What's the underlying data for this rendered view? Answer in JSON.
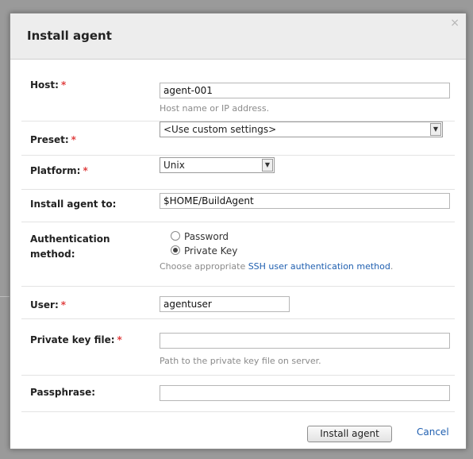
{
  "dialog": {
    "title": "Install agent",
    "close_glyph": "×"
  },
  "required_marker": "*",
  "fields": {
    "host": {
      "label": "Host:",
      "value": "agent-001",
      "hint": "Host name or IP address."
    },
    "preset": {
      "label": "Preset:",
      "value": "<Use custom settings>"
    },
    "platform": {
      "label": "Platform:",
      "value": "Unix"
    },
    "install_to": {
      "label": "Install agent to:",
      "value": "$HOME/BuildAgent"
    },
    "auth": {
      "label_line1": "Authentication",
      "label_line2": "method:",
      "options": [
        "Password",
        "Private Key"
      ],
      "selected": "Private Key",
      "hint_prefix": "Choose appropriate ",
      "hint_link": "SSH user authentication method",
      "hint_suffix": "."
    },
    "user": {
      "label": "User:",
      "value": "agentuser"
    },
    "key_file": {
      "label": "Private key file:",
      "value": "",
      "hint": "Path to the private key file on server."
    },
    "passphrase": {
      "label": "Passphrase:",
      "value": ""
    }
  },
  "footer": {
    "install_label": "Install agent",
    "cancel_label": "Cancel"
  },
  "icons": [
    "close-icon",
    "dropdown-arrow-icon",
    "radio-icon"
  ]
}
